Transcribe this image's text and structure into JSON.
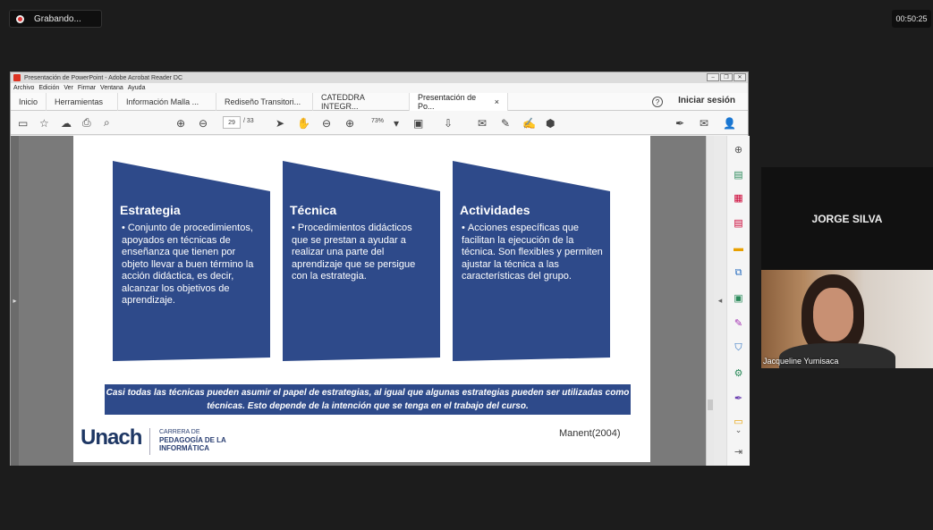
{
  "recording": {
    "label": "Grabando..."
  },
  "clock": "00:50:25",
  "window": {
    "title": "Presentación de PowerPoint - Adobe Acrobat Reader DC",
    "menu": [
      "Archivo",
      "Edición",
      "Ver",
      "Firmar",
      "Ventana",
      "Ayuda"
    ]
  },
  "tabs": [
    {
      "label": "Inicio"
    },
    {
      "label": "Herramientas"
    },
    {
      "label": "Información Malla ..."
    },
    {
      "label": "Rediseño Transitori..."
    },
    {
      "label": "CATEDDRA INTEGR..."
    },
    {
      "label": "Presentación de Po...",
      "close": "×"
    }
  ],
  "login": "Iniciar sesión",
  "toolbar": {
    "page_current": "29",
    "page_total": "/ 33",
    "zoom": "73%"
  },
  "slide": {
    "panels": [
      {
        "title": "Estrategia",
        "text": "Conjunto de procedimientos, apoyados en técnicas de enseñanza que tienen por objeto llevar a buen término la acción didáctica, es decir, alcanzar los objetivos de aprendizaje."
      },
      {
        "title": "Técnica",
        "text": "Procedimientos didácticos que se prestan a ayudar a realizar una parte del aprendizaje que se persigue con la estrategia."
      },
      {
        "title": "Actividades",
        "text": "Acciones específicas que facilitan la ejecución de la técnica. Son flexibles y permiten ajustar la técnica a las características del grupo."
      }
    ],
    "note": "Casi todas las técnicas pueden asumir el papel de estrategias, al igual que algunas estrategias pueden ser utilizadas como técnicas. Esto depende de la intención que se tenga en el trabajo del curso.",
    "logo": "Unach",
    "career_line1": "CARRERA DE",
    "career_line2": "PEDAGOGÍA DE LA",
    "career_line3": "INFORMÁTICA",
    "citation": "Manent(2004)",
    "panel_color": "#2e4a8a"
  },
  "participants": {
    "host_name": "JORGE SILVA",
    "video_name": "Jacqueline Yumisaca"
  }
}
